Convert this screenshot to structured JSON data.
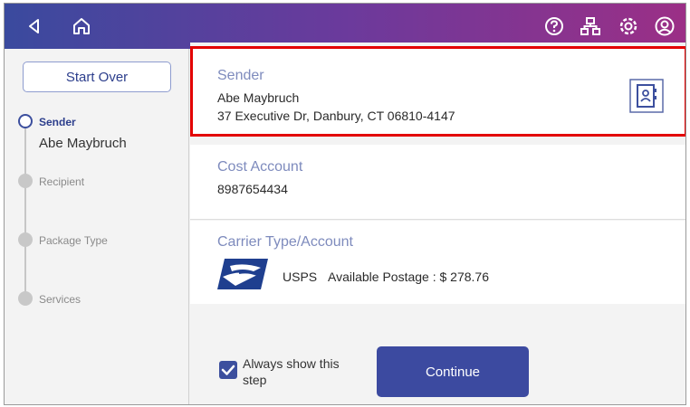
{
  "topbar": {
    "back_icon": "back-triangle-icon",
    "home_icon": "home-icon",
    "right_icons": [
      "help-icon",
      "network-icon",
      "settings-icon",
      "account-icon"
    ]
  },
  "sidebar": {
    "start_over_label": "Start Over",
    "steps": [
      {
        "label": "Sender",
        "value": "Abe Maybruch",
        "state": "active"
      },
      {
        "label": "Recipient",
        "state": "pending"
      },
      {
        "label": "Package Type",
        "state": "pending"
      },
      {
        "label": "Services",
        "state": "pending"
      }
    ]
  },
  "sender": {
    "heading": "Sender",
    "name": "Abe Maybruch",
    "address": "37 Executive Dr, Danbury, CT 06810-4147",
    "address_book_icon": "address-book-icon"
  },
  "cost_account": {
    "heading": "Cost Account",
    "value": "8987654434"
  },
  "carrier": {
    "heading": "Carrier Type/Account",
    "carrier_name": "USPS",
    "postage_label": "Available Postage : $ 278.76",
    "logo_icon": "usps-eagle-icon"
  },
  "footer": {
    "checkbox_label": "Always show this step",
    "checkbox_checked": true,
    "continue_label": "Continue"
  },
  "colors": {
    "highlight": "#e30000",
    "accent": "#3c4aa0",
    "topbar_start": "#3a4a9e",
    "topbar_end": "#9b2f86"
  }
}
